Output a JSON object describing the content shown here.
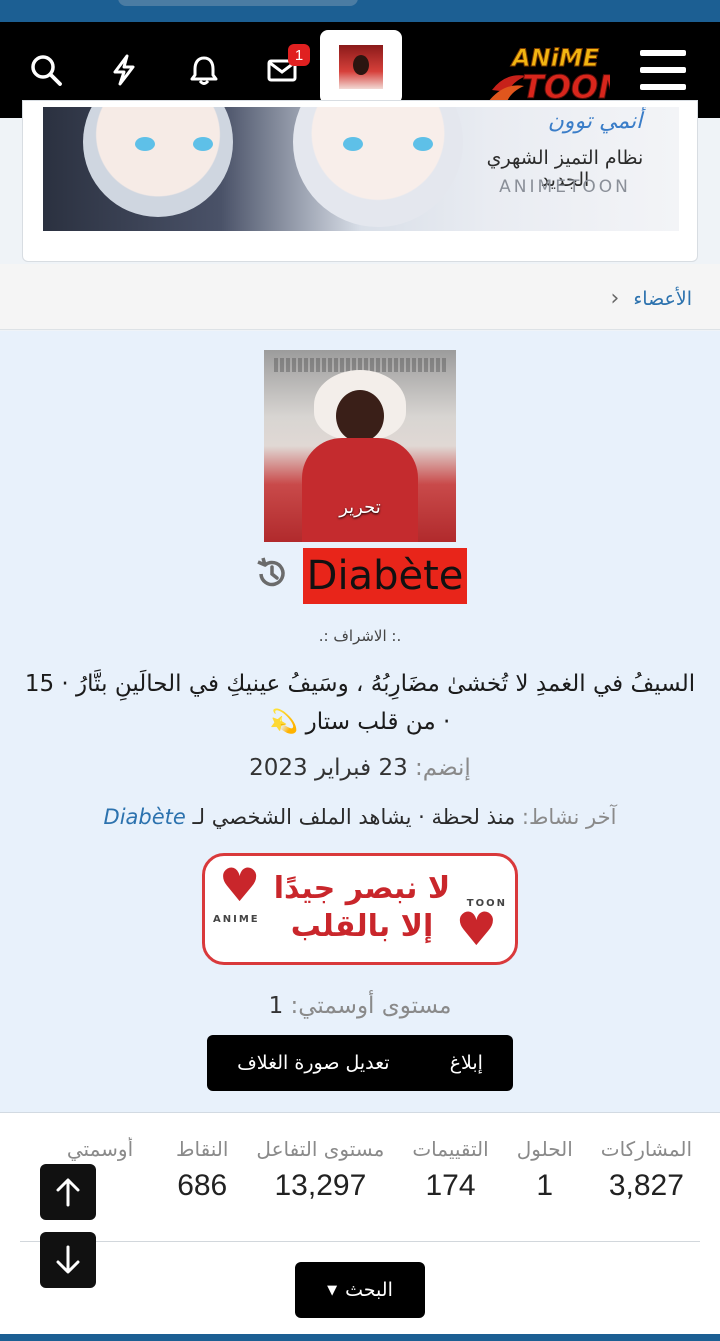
{
  "topbar": {
    "notification_count": "1",
    "logo_text": "ANiME TOON",
    "icons": [
      "search-icon",
      "lightning-icon",
      "bell-icon",
      "mail-icon",
      "menu-icon"
    ]
  },
  "banner": {
    "line1": "أنمي توون",
    "line2": "نظام التميز الشهري الجديد",
    "line3": "ANIMETOON"
  },
  "breadcrumb": {
    "item": "الأعضاء"
  },
  "profile": {
    "cover_edit_label": "تحرير",
    "username": "Diabète",
    "role": ".: الاشراف :.",
    "bio": "السيفُ في الغمدِ لا تُخشىٰ مضَارِبُهُ ، وسَيفُ عينيكِ في الحالَينِ بتَّارُ · 15 · من قلب ستار 💫",
    "joined_label": "إنضم:",
    "joined_value": "23 فبراير 2023",
    "last_activity_label": "آخر نشاط:",
    "last_activity_value": "منذ لحظة · يشاهد الملف الشخصي لـ",
    "last_activity_link": "Diabète",
    "award_text": "لا نبصر جيدًا إلا بالقلب",
    "award_left_brand": "ANIME",
    "award_right_brand": "TOON",
    "level_label": "مستوى أوسمتي:",
    "level_value": "1",
    "actions": {
      "report": "إبلاغ",
      "edit_cover": "تعديل صورة الغلاف"
    }
  },
  "stats": [
    {
      "label": "المشاركات",
      "value": "3,827"
    },
    {
      "label": "الحلول",
      "value": "1"
    },
    {
      "label": "التقييمات",
      "value": "174"
    },
    {
      "label": "مستوى التفاعل",
      "value": "13,297"
    },
    {
      "label": "النقاط",
      "value": "686"
    },
    {
      "label": "أوسمتي",
      "value": ""
    }
  ],
  "search_button": "البحث",
  "colors": {
    "accent": "#1c5f93",
    "username_highlight": "#e8251a",
    "link": "#2c72ae"
  }
}
